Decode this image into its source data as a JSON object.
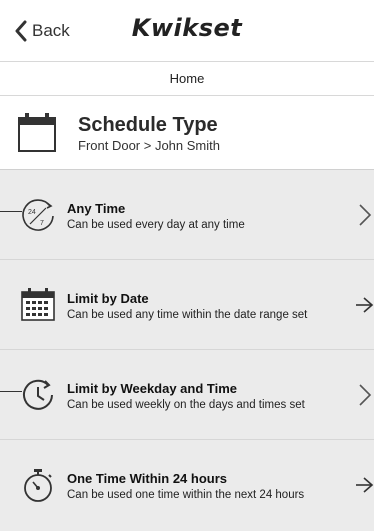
{
  "nav": {
    "back_label": "Back",
    "brand": "Kwikset",
    "tab": "Home"
  },
  "header": {
    "icon": "calendar-icon",
    "title": "Schedule Type",
    "subtitle": "Front Door > John Smith"
  },
  "options": [
    {
      "icon": "24-7-clock-icon",
      "title": "Any Time",
      "description": "Can be used every day at any time",
      "arrow": "chevron"
    },
    {
      "icon": "calendar-grid-icon",
      "title": "Limit by Date",
      "description": "Can be used any time within the date range set",
      "arrow": "arrow"
    },
    {
      "icon": "clock-icon",
      "title": "Limit by Weekday and Time",
      "description": "Can be used weekly on the days and times set",
      "arrow": "chevron"
    },
    {
      "icon": "stopwatch-icon",
      "title": "One Time Within 24 hours",
      "description": "Can be used one time within the next 24 hours",
      "arrow": "arrow"
    }
  ],
  "colors": {
    "list_background": "#ebebeb",
    "text": "#222222"
  }
}
